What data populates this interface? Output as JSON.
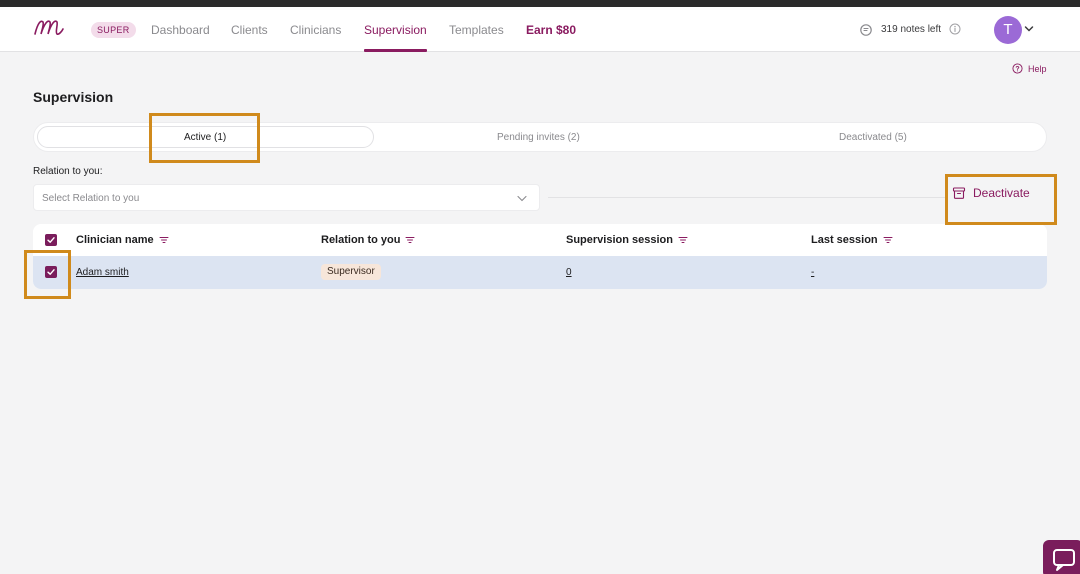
{
  "header": {
    "badge": "SUPER",
    "nav": [
      {
        "label": "Dashboard"
      },
      {
        "label": "Clients"
      },
      {
        "label": "Clinicians"
      },
      {
        "label": "Supervision"
      },
      {
        "label": "Templates"
      },
      {
        "label": "Earn $80"
      }
    ],
    "notes_left": "319 notes left",
    "avatar_initial": "T"
  },
  "help_label": "Help",
  "page_title": "Supervision",
  "tabs": [
    {
      "label": "Active (1)",
      "active": true
    },
    {
      "label": "Pending invites (2)",
      "active": false
    },
    {
      "label": "Deactivated (5)",
      "active": false
    }
  ],
  "filter": {
    "label": "Relation to you:",
    "placeholder": "Select Relation to you"
  },
  "deactivate_label": "Deactivate",
  "table": {
    "columns": [
      "Clinician name",
      "Relation to you",
      "Supervision session",
      "Last session"
    ],
    "rows": [
      {
        "name": "Adam smith",
        "relation": "Supervisor",
        "sessions": "0",
        "last_session": "-",
        "checked": true
      }
    ],
    "select_all_checked": true
  },
  "colors": {
    "accent": "#8a1b60",
    "checkbox": "#7a1d5c",
    "selected_row": "#dce4f2",
    "avatar": "#9b6ad6",
    "highlight": "#d08a1c"
  },
  "icons": [
    "logo-icon",
    "notes-icon",
    "info-icon",
    "chevron-down-icon",
    "help-icon",
    "filter-icon",
    "check-icon",
    "archive-icon",
    "chat-icon"
  ]
}
